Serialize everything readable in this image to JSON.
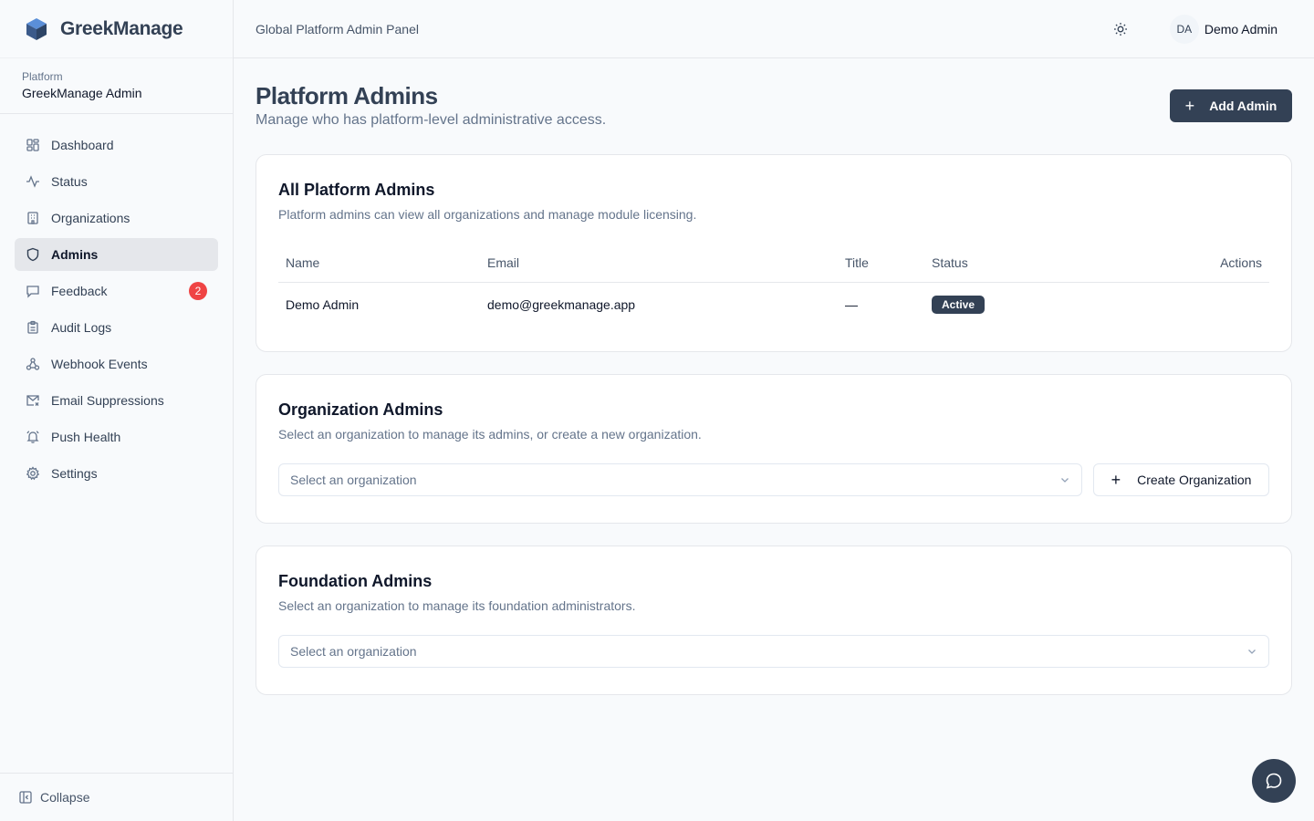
{
  "brand": {
    "name": "GreekManage"
  },
  "platform": {
    "label": "Platform",
    "name": "GreekManage Admin"
  },
  "sidebar": {
    "items": [
      {
        "label": "Dashboard",
        "icon": "dashboard-icon"
      },
      {
        "label": "Status",
        "icon": "activity-icon"
      },
      {
        "label": "Organizations",
        "icon": "building-icon"
      },
      {
        "label": "Admins",
        "icon": "shield-icon",
        "active": true
      },
      {
        "label": "Feedback",
        "icon": "message-icon",
        "badge": "2"
      },
      {
        "label": "Audit Logs",
        "icon": "clipboard-icon"
      },
      {
        "label": "Webhook Events",
        "icon": "webhook-icon"
      },
      {
        "label": "Email Suppressions",
        "icon": "mail-x-icon"
      },
      {
        "label": "Push Health",
        "icon": "bell-icon"
      },
      {
        "label": "Settings",
        "icon": "gear-icon"
      }
    ],
    "collapse_label": "Collapse"
  },
  "topbar": {
    "title": "Global Platform Admin Panel",
    "avatar_initials": "DA",
    "user_name": "Demo Admin"
  },
  "page": {
    "title": "Platform Admins",
    "subtitle": "Manage who has platform-level administrative access.",
    "add_button": "Add Admin"
  },
  "platform_admins": {
    "title": "All Platform Admins",
    "description": "Platform admins can view all organizations and manage module licensing.",
    "columns": {
      "name": "Name",
      "email": "Email",
      "title": "Title",
      "status": "Status",
      "actions": "Actions"
    },
    "rows": [
      {
        "name": "Demo Admin",
        "email": "demo@greekmanage.app",
        "title": "—",
        "status": "Active"
      }
    ]
  },
  "org_admins": {
    "title": "Organization Admins",
    "description": "Select an organization to manage its admins, or create a new organization.",
    "select_placeholder": "Select an organization",
    "create_button": "Create Organization"
  },
  "foundation_admins": {
    "title": "Foundation Admins",
    "description": "Select an organization to manage its foundation administrators.",
    "select_placeholder": "Select an organization"
  },
  "colors": {
    "primary": "#334155",
    "badge": "#ef4444",
    "border": "#e5e7eb"
  }
}
